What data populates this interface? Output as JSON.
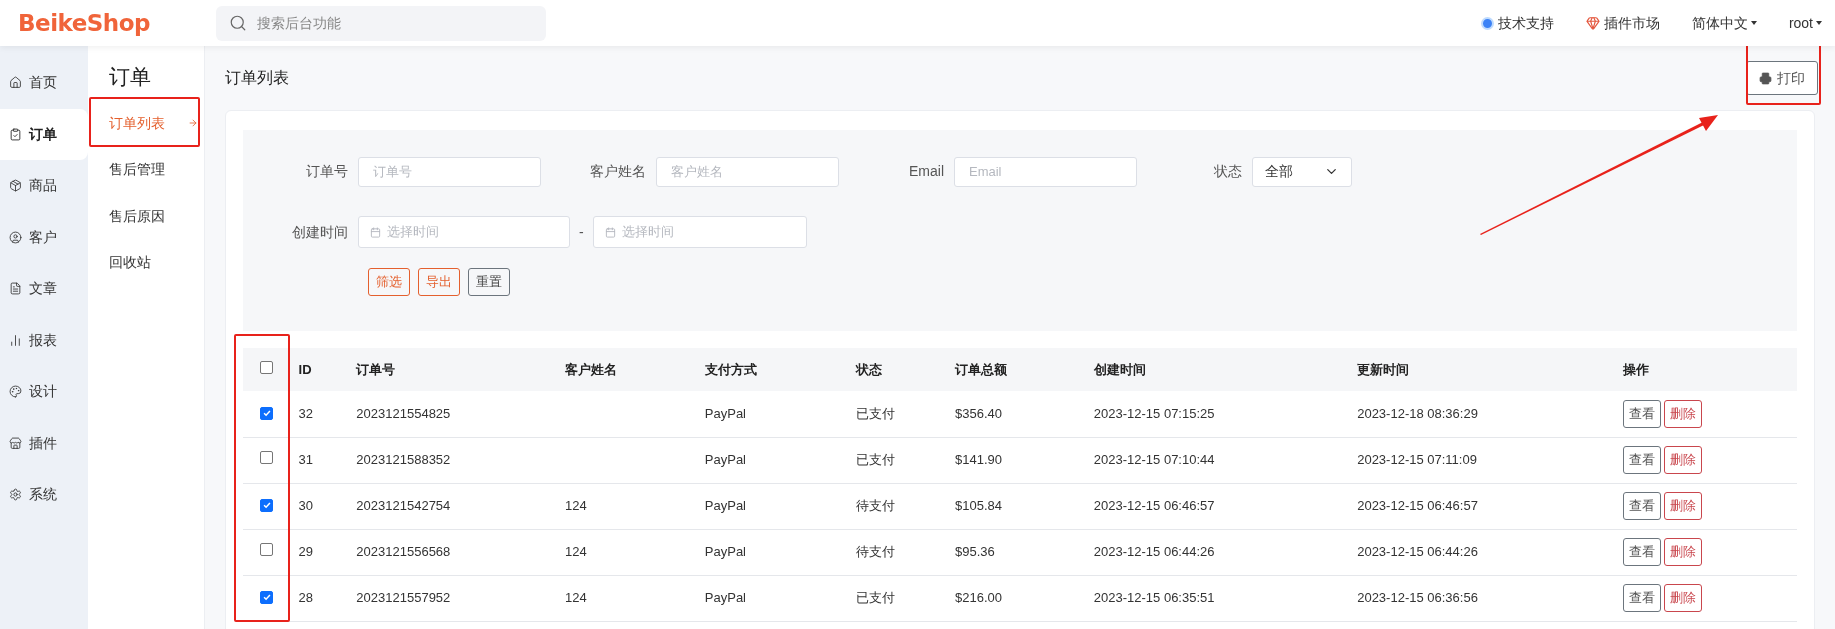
{
  "header": {
    "logo": "BeikeShop",
    "search": {
      "placeholder": "搜索后台功能"
    },
    "links": [
      {
        "label": "技术支持",
        "kind": "support"
      },
      {
        "label": "插件市场",
        "kind": "market"
      }
    ],
    "menus": [
      "简体中文",
      "root"
    ]
  },
  "sidebar": {
    "items": [
      {
        "label": "首页",
        "selected": false
      },
      {
        "label": "订单",
        "selected": true
      },
      {
        "label": "商品",
        "selected": false
      },
      {
        "label": "客户",
        "selected": false
      },
      {
        "label": "文章",
        "selected": false
      },
      {
        "label": "报表",
        "selected": false
      },
      {
        "label": "设计",
        "selected": false
      },
      {
        "label": "插件",
        "selected": false
      },
      {
        "label": "系统",
        "selected": false
      }
    ]
  },
  "submenu": {
    "title": "订单",
    "items": [
      {
        "label": "订单列表",
        "selected": true
      },
      {
        "label": "售后管理",
        "selected": false
      },
      {
        "label": "售后原因",
        "selected": false
      },
      {
        "label": "回收站",
        "selected": false
      }
    ]
  },
  "page": {
    "title": "订单列表",
    "print_button": "打印"
  },
  "filters": {
    "fields": [
      {
        "label": "订单号",
        "placeholder": "订单号",
        "kind": "text"
      },
      {
        "label": "客户姓名",
        "placeholder": "客户姓名",
        "kind": "text"
      },
      {
        "label": "Email",
        "placeholder": "Email",
        "kind": "text"
      },
      {
        "label": "状态",
        "value": "全部",
        "kind": "select"
      }
    ],
    "date": {
      "label": "创建时间",
      "from_placeholder": "选择时间",
      "separator": "-",
      "to_placeholder": "选择时间"
    },
    "buttons": [
      {
        "label": "筛选",
        "kind": "primary"
      },
      {
        "label": "导出",
        "kind": "primary"
      },
      {
        "label": "重置",
        "kind": "secondary"
      }
    ]
  },
  "table": {
    "select_all": {
      "checked": false
    },
    "columns": [
      "ID",
      "订单号",
      "客户姓名",
      "支付方式",
      "状态",
      "订单总额",
      "创建时间",
      "更新时间",
      "操作"
    ],
    "rows": [
      {
        "checked": true,
        "cells": [
          "32",
          "2023121554825",
          "",
          "PayPal",
          "已支付",
          "$356.40",
          "2023-12-15 07:15:25",
          "2023-12-18 08:36:29"
        ],
        "actions": [
          {
            "label": "查看",
            "kind": "view"
          },
          {
            "label": "删除",
            "kind": "delete"
          }
        ]
      },
      {
        "checked": false,
        "cells": [
          "31",
          "2023121588352",
          "",
          "PayPal",
          "已支付",
          "$141.90",
          "2023-12-15 07:10:44",
          "2023-12-15 07:11:09"
        ],
        "actions": [
          {
            "label": "查看",
            "kind": "view"
          },
          {
            "label": "删除",
            "kind": "delete"
          }
        ]
      },
      {
        "checked": true,
        "cells": [
          "30",
          "2023121542754",
          "124",
          "PayPal",
          "待支付",
          "$105.84",
          "2023-12-15 06:46:57",
          "2023-12-15 06:46:57"
        ],
        "actions": [
          {
            "label": "查看",
            "kind": "view"
          },
          {
            "label": "删除",
            "kind": "delete"
          }
        ]
      },
      {
        "checked": false,
        "cells": [
          "29",
          "2023121556568",
          "124",
          "PayPal",
          "待支付",
          "$95.36",
          "2023-12-15 06:44:26",
          "2023-12-15 06:44:26"
        ],
        "actions": [
          {
            "label": "查看",
            "kind": "view"
          },
          {
            "label": "删除",
            "kind": "delete"
          }
        ]
      },
      {
        "checked": true,
        "cells": [
          "28",
          "2023121557952",
          "124",
          "PayPal",
          "已支付",
          "$216.00",
          "2023-12-15 06:35:51",
          "2023-12-15 06:36:56"
        ],
        "actions": [
          {
            "label": "查看",
            "kind": "view"
          },
          {
            "label": "删除",
            "kind": "delete"
          }
        ]
      }
    ]
  }
}
